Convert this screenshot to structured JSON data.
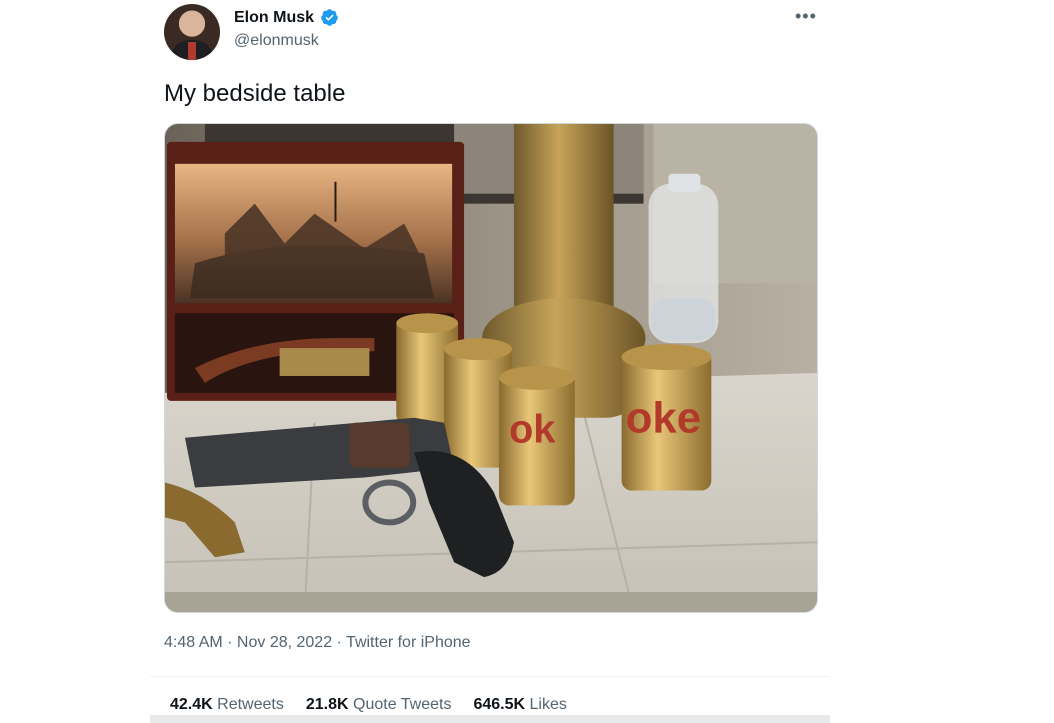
{
  "author": {
    "name": "Elon Musk",
    "handle": "@elonmusk",
    "verified": true
  },
  "tweet": {
    "text": "My bedside table",
    "time": "4:48 AM",
    "date": "Nov 28, 2022",
    "source": "Twitter for iPhone",
    "separator": " · "
  },
  "stats": {
    "retweets": {
      "count": "42.4K",
      "label": "Retweets"
    },
    "quotes": {
      "count": "21.8K",
      "label": "Quote Tweets"
    },
    "likes": {
      "count": "646.5K",
      "label": "Likes"
    }
  },
  "icons": {
    "verified": "verified-badge-icon",
    "more": "more-options-icon"
  },
  "colors": {
    "verified_blue": "#1d9bf0",
    "secondary_text": "#536471",
    "primary_text": "#0f1419"
  }
}
